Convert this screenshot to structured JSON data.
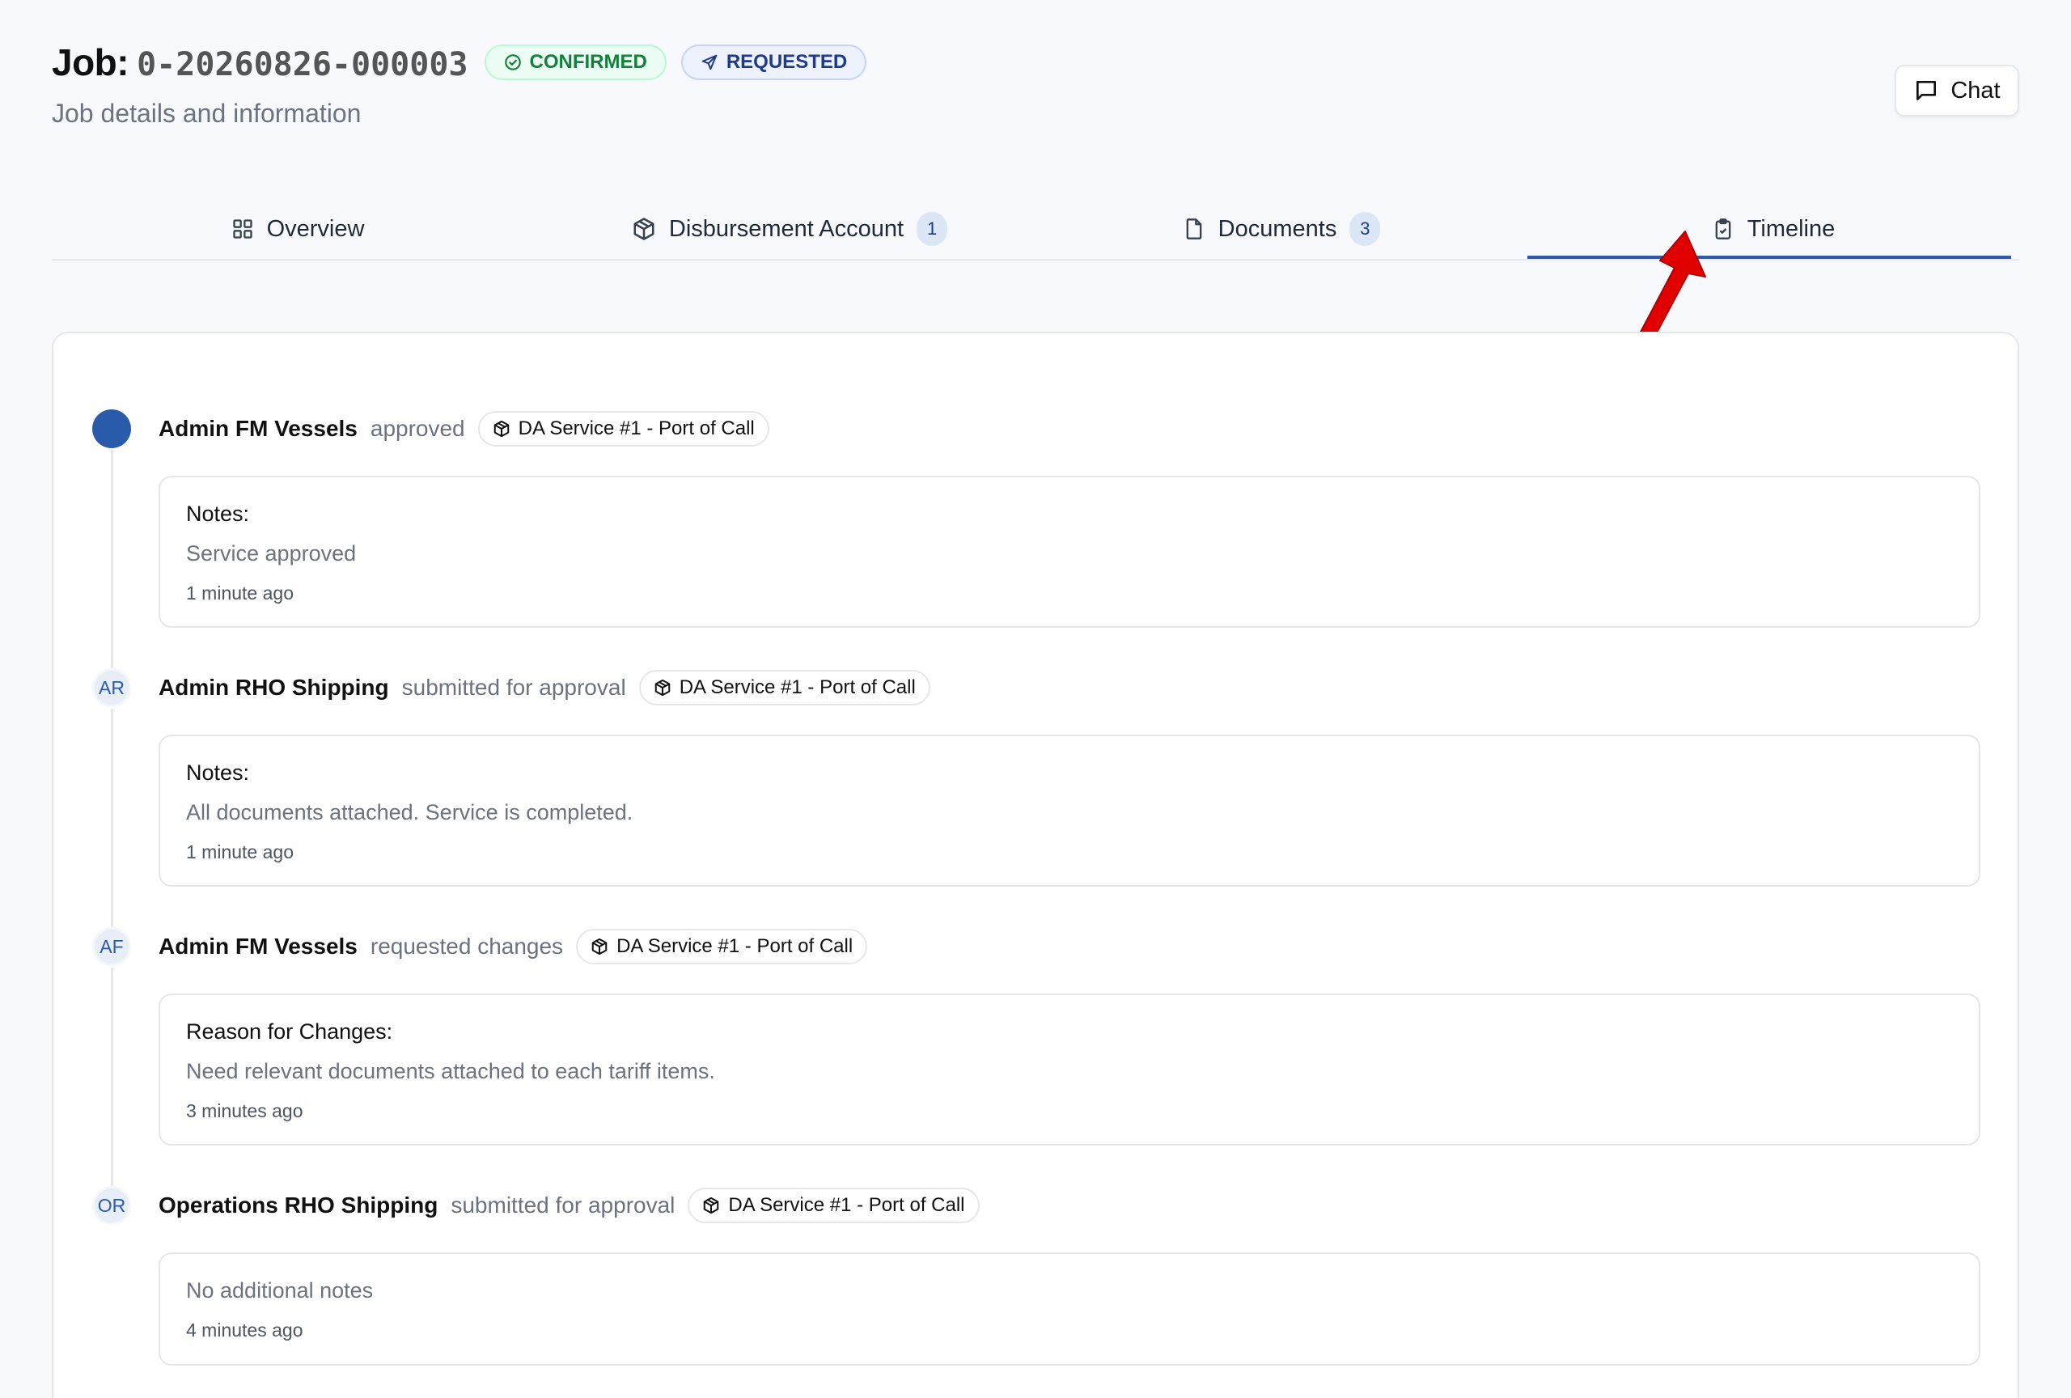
{
  "header": {
    "job_label": "Job:",
    "job_id": "0-20260826-000003",
    "subtitle": "Job details and information",
    "badges": {
      "confirmed": "CONFIRMED",
      "requested": "REQUESTED"
    },
    "chat_label": "Chat"
  },
  "tabs": [
    {
      "label": "Overview",
      "icon": "grid-icon"
    },
    {
      "label": "Disbursement Account",
      "icon": "package-icon",
      "count": "1"
    },
    {
      "label": "Documents",
      "icon": "file-icon",
      "count": "3"
    },
    {
      "label": "Timeline",
      "icon": "clipboard-check-icon",
      "active": true
    }
  ],
  "timeline": [
    {
      "avatar": "",
      "actor": "Admin FM Vessels",
      "action": "approved",
      "service": "DA Service #1 - Port of Call",
      "note_label": "Notes:",
      "note_text": "Service approved",
      "time": "1 minute ago"
    },
    {
      "avatar": "AR",
      "actor": "Admin RHO Shipping",
      "action": "submitted for approval",
      "service": "DA Service #1 - Port of Call",
      "note_label": "Notes:",
      "note_text": "All documents attached. Service is completed.",
      "time": "1 minute ago"
    },
    {
      "avatar": "AF",
      "actor": "Admin FM Vessels",
      "action": "requested changes",
      "service": "DA Service #1 - Port of Call",
      "note_label": "Reason for Changes:",
      "note_text": "Need relevant documents attached to each tariff items.",
      "time": "3 minutes ago"
    },
    {
      "avatar": "OR",
      "actor": "Operations RHO Shipping",
      "action": "submitted for approval",
      "service": "DA Service #1 - Port of Call",
      "note_text": "No additional notes",
      "time": "4 minutes ago"
    }
  ],
  "colors": {
    "accent": "#2f5aa8",
    "confirmed": "#15803d",
    "requested": "#1e3a8a",
    "annotation_arrow": "#e00000"
  }
}
